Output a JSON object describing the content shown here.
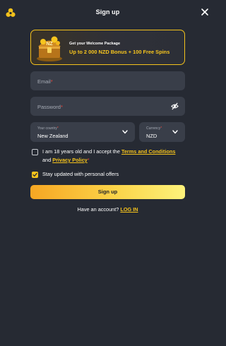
{
  "header": {
    "title": "Sign up"
  },
  "promo": {
    "subtitle": "Get your Welcome Package",
    "headline": "Up to 2 000 NZD Bonus + 100 Free Spins"
  },
  "form": {
    "email_placeholder": "Email",
    "password_placeholder": "Password",
    "required_mark": "*",
    "country": {
      "label": "Your country",
      "value": "New Zealand"
    },
    "currency": {
      "label": "Currency",
      "value": "NZD"
    },
    "terms": {
      "checked": false,
      "text_1": "I am 18 years old and I accept the ",
      "terms_link": "Terms and Conditions",
      "text_2": " and ",
      "privacy_link": "Privacy Policy"
    },
    "offers": {
      "checked": true,
      "text": "Stay updated with personal offers"
    },
    "submit_label": "Sign up"
  },
  "footer": {
    "prompt": "Have an account?",
    "login_link": "LOG IN"
  },
  "colors": {
    "accent": "#f4c21c",
    "background": "#262a33",
    "field": "#393e49"
  },
  "icons": [
    "logo-icon",
    "close-icon",
    "eye-off-icon",
    "chevron-down-icon",
    "check-icon"
  ]
}
